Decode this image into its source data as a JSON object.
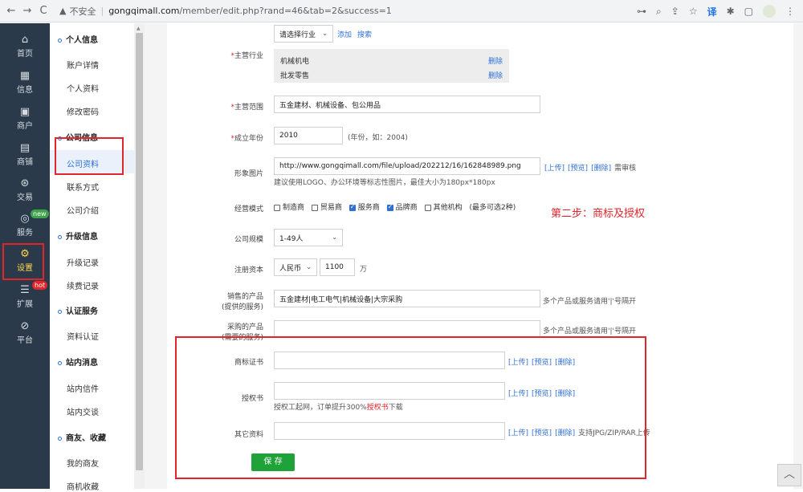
{
  "browser": {
    "back": "←",
    "forward": "→",
    "reload": "C",
    "warning": "▲",
    "insecure": "不安全",
    "separator": "|",
    "host": "gongqimall.com",
    "path": "/member/edit.php?rand=46&tab=2&success=1",
    "icons": [
      "key-icon",
      "zoom-icon",
      "share-icon",
      "star-icon",
      "translate-icon",
      "puzzle-icon",
      "window-icon",
      "avatar-icon",
      "menu-icon"
    ],
    "key": "⊶",
    "zoom": "⌕",
    "share": "⇪",
    "star": "☆",
    "translate": "译",
    "puzzle": "✱",
    "window": "▢",
    "menu": "⋮"
  },
  "rail": [
    {
      "icon": "home-icon",
      "glyph": "⌂",
      "label": "首页"
    },
    {
      "icon": "info-icon",
      "glyph": "▦",
      "label": "信息"
    },
    {
      "icon": "merchant-icon",
      "glyph": "▣",
      "label": "商户"
    },
    {
      "icon": "shop-icon",
      "glyph": "▤",
      "label": "商铺"
    },
    {
      "icon": "trade-icon",
      "glyph": "⊛",
      "label": "交易"
    },
    {
      "icon": "service-icon",
      "glyph": "◎",
      "label": "服务",
      "badge": "new"
    },
    {
      "icon": "settings-icon",
      "glyph": "⚙",
      "label": "设置"
    },
    {
      "icon": "extend-icon",
      "glyph": "☰",
      "label": "扩展",
      "badge": "hot"
    },
    {
      "icon": "platform-icon",
      "glyph": "⊘",
      "label": "平台"
    }
  ],
  "submenu": {
    "groups": [
      {
        "title": "个人信息",
        "items": [
          "账户详情",
          "个人资料",
          "修改密码"
        ]
      },
      {
        "title": "公司信息",
        "items": [
          "公司资料",
          "联系方式",
          "公司介绍"
        ]
      },
      {
        "title": "升级信息",
        "items": [
          "升级记录",
          "续费记录"
        ]
      },
      {
        "title": "认证服务",
        "items": [
          "资料认证"
        ]
      },
      {
        "title": "站内消息",
        "items": [
          "站内信件",
          "站内交谈"
        ]
      },
      {
        "title": "商友、收藏",
        "items": [
          "我的商友",
          "商机收藏"
        ]
      }
    ]
  },
  "form": {
    "industry_select": "请选择行业",
    "industry_add": "添加",
    "industry_search": "搜索",
    "main_industry_label": "主营行业",
    "industries": [
      "机械机电",
      "批发零售"
    ],
    "delete": "删除",
    "scope_label": "主营范围",
    "scope_value": "五金建材、机械设备、包公用品",
    "year_label": "成立年份",
    "year_value": "2010",
    "year_hint": "(年份，如：2004)",
    "image_label": "形象图片",
    "image_value": "http://www.gongqimall.com/file/upload/202212/16/162848989.png",
    "image_actions": [
      "[上传]",
      "[预览]",
      "[删除]"
    ],
    "image_review": "需审核",
    "image_hint": "建议使用LOGO、办公环境等标志性图片，最佳大小为180px*180px",
    "mode_label": "经营模式",
    "modes": [
      {
        "label": "制造商",
        "checked": false
      },
      {
        "label": "贸易商",
        "checked": false
      },
      {
        "label": "服务商",
        "checked": true
      },
      {
        "label": "品牌商",
        "checked": true
      },
      {
        "label": "其他机构",
        "checked": false
      }
    ],
    "mode_hint": "(最多可选2种)",
    "step_note": "第二步：商标及授权",
    "size_label": "公司规模",
    "size_value": "1-49人",
    "capital_label": "注册资本",
    "currency": "人民币",
    "capital_value": "1100",
    "capital_unit": "万",
    "sell_label_1": "销售的产品",
    "sell_label_2": "(提供的服务)",
    "sell_value": "五金建材|电工电气|机械设备|大宗采购",
    "sell_hint": "多个产品或服务请用'|'号隔开",
    "buy_label_1": "采购的产品",
    "buy_label_2": "(需要的服务)",
    "buy_value": "",
    "buy_hint": "多个产品或服务请用'|'号隔开",
    "trademark_label": "商标证书",
    "auth_label": "授权书",
    "auth_hint_prefix": "授权工起网，订单提升300%",
    "auth_hint_link": "授权书",
    "auth_hint_suffix": "下载",
    "other_label": "其它资料",
    "upload_actions": [
      "[上传]",
      "[预览]",
      "[删除]"
    ],
    "other_hint": "支持JPG/ZIP/RAR上传",
    "save": "保 存",
    "required_mark": "*"
  },
  "back_to_top": "︿",
  "colors": {
    "sidebar": "#2b3a4a",
    "active_rail": "#ffd84d",
    "link": "#2f6fd6",
    "highlight": "#e0262b",
    "save": "#1fa339"
  }
}
